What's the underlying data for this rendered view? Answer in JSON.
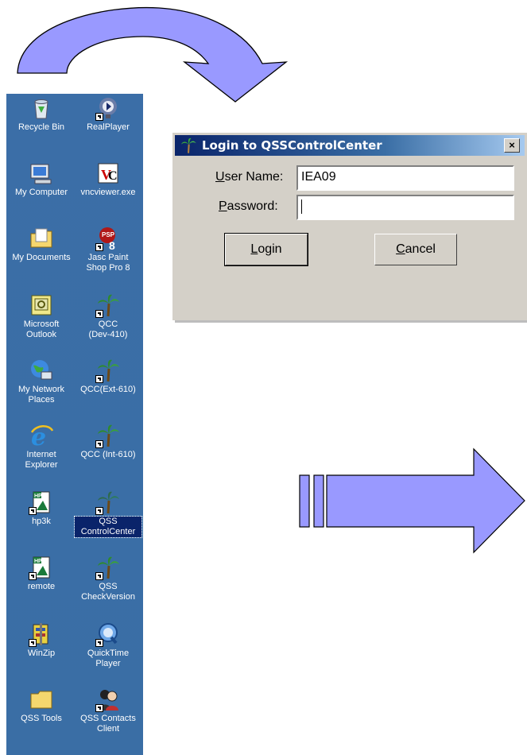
{
  "desktop": {
    "icons": [
      {
        "label": "Recycle Bin"
      },
      {
        "label": "RealPlayer"
      },
      {
        "label": "My Computer"
      },
      {
        "label": "vncviewer.exe"
      },
      {
        "label": "My Documents"
      },
      {
        "label": "Jasc Paint\nShop Pro 8"
      },
      {
        "label": "Microsoft\nOutlook"
      },
      {
        "label": "QCC\n(Dev-410)"
      },
      {
        "label": "My Network\nPlaces"
      },
      {
        "label": "QCC(Ext-610)"
      },
      {
        "label": "Internet\nExplorer"
      },
      {
        "label": "QCC (Int-610)"
      },
      {
        "label": "hp3k"
      },
      {
        "label": "QSS\nControlCenter"
      },
      {
        "label": "remote"
      },
      {
        "label": "QSS\nCheckVersion"
      },
      {
        "label": "WinZip"
      },
      {
        "label": "QuickTime\nPlayer"
      },
      {
        "label": "QSS Tools"
      },
      {
        "label": "QSS Contacts\nClient"
      }
    ]
  },
  "dialog": {
    "title": "Login to QSSControlCenter",
    "close": "×",
    "username": {
      "label_hot": "U",
      "label_rest": "ser Name:",
      "value": "IEA09"
    },
    "password": {
      "label_hot": "P",
      "label_rest": "assword:",
      "value": ""
    },
    "login": {
      "hot": "L",
      "rest": "ogin"
    },
    "cancel": {
      "hot": "C",
      "rest": "ancel"
    }
  },
  "colors": {
    "desktop": "#3a6ea5",
    "arrow_fill": "#9999ff",
    "dialog_bg": "#d4d0c8",
    "title_bar": "#0a246a"
  }
}
